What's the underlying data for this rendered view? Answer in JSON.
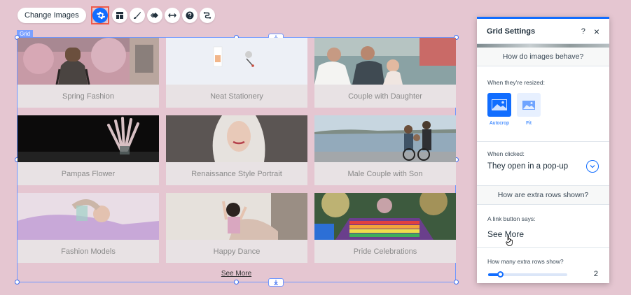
{
  "toolbar": {
    "change_images_label": "Change Images",
    "icons": [
      "gear-icon",
      "layout-icon",
      "design-brush-icon",
      "animation-icon",
      "stretch-icon",
      "help-icon",
      "connect-icon"
    ]
  },
  "grid": {
    "tag": "Grid",
    "items": [
      {
        "label": "Spring Fashion"
      },
      {
        "label": "Neat Stationery"
      },
      {
        "label": "Couple with Daughter"
      },
      {
        "label": "Pampas Flower"
      },
      {
        "label": "Renaissance Style Portrait"
      },
      {
        "label": "Male Couple with Son"
      },
      {
        "label": "Fashion Models"
      },
      {
        "label": "Happy Dance"
      },
      {
        "label": "Pride Celebrations"
      }
    ],
    "see_more": "See More"
  },
  "panel": {
    "title": "Grid Settings",
    "help": "?",
    "close": "×",
    "section_images": "How do images behave?",
    "resized_label": "When they're resized:",
    "options": [
      {
        "caption": "Autocrop",
        "selected": true
      },
      {
        "caption": "Fit",
        "selected": false
      }
    ],
    "clicked_label": "When clicked:",
    "clicked_value": "They open in a pop-up",
    "section_rows": "How are extra rows shown?",
    "link_label": "A link button says:",
    "link_value": "See More",
    "rows_label": "How many extra rows show?",
    "rows_value": "2",
    "rows_fraction": 0.15
  },
  "colors": {
    "background": "#e5c6d1",
    "accent": "#116dff",
    "highlight": "#ef5a4b"
  }
}
